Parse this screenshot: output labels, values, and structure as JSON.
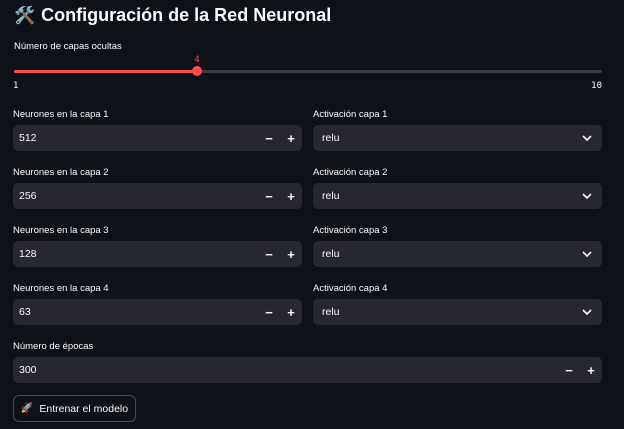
{
  "title": {
    "icon": "🛠️",
    "text": "Configuración de la Red Neuronal"
  },
  "hidden_layers": {
    "label": "Número de capas ocultas",
    "value": 4,
    "value_text": "4",
    "min": "1",
    "max": "10",
    "min_value": 1,
    "max_value": 10,
    "accent_color": "#ff4b4b"
  },
  "layers": [
    {
      "neurons_label": "Neurones en la capa 1",
      "neurons_value": "512",
      "activation_label": "Activación capa 1",
      "activation_value": "relu"
    },
    {
      "neurons_label": "Neurones en la capa 2",
      "neurons_value": "256",
      "activation_label": "Activación capa 2",
      "activation_value": "relu"
    },
    {
      "neurons_label": "Neurones en la capa 3",
      "neurons_value": "128",
      "activation_label": "Activación capa 3",
      "activation_value": "relu"
    },
    {
      "neurons_label": "Neurones en la capa 4",
      "neurons_value": "63",
      "activation_label": "Activación capa 4",
      "activation_value": "relu"
    }
  ],
  "stepper": {
    "minus": "−",
    "plus": "+"
  },
  "epochs": {
    "label": "Número de épocas",
    "value": "300"
  },
  "train_button": {
    "icon": "🚀",
    "label": "Entrenar el modelo"
  },
  "colors": {
    "background": "#0e1117",
    "input_bg": "#262730",
    "text": "#fafafa"
  },
  "icons": {
    "title": "tools-icon",
    "select": "chevron-down-icon",
    "button": "rocket-icon"
  }
}
